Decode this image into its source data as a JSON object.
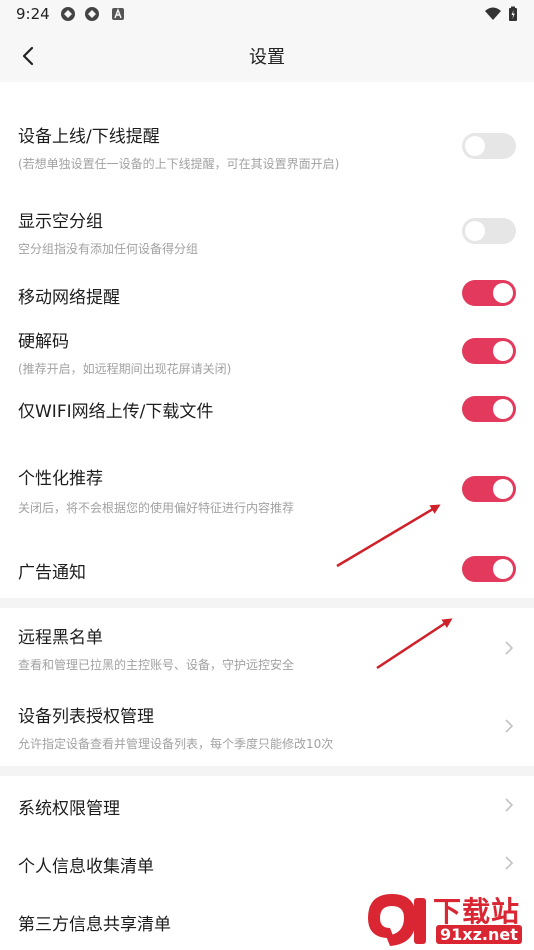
{
  "status_bar": {
    "time": "9:24"
  },
  "header": {
    "title": "设置"
  },
  "settings": [
    {
      "title": "设备上线/下线提醒",
      "subtitle": "(若想单独设置任一设备的上下线提醒，可在其设置界面开启)",
      "toggle": "off"
    },
    {
      "title": "显示空分组",
      "subtitle": "空分组指没有添加任何设备得分组",
      "toggle": "off"
    },
    {
      "title": "移动网络提醒",
      "subtitle": "",
      "toggle": "on"
    },
    {
      "title": "硬解码",
      "subtitle": "(推荐开启，如远程期间出现花屏请关闭)",
      "toggle": "on"
    },
    {
      "title": "仅WIFI网络上传/下载文件",
      "subtitle": "",
      "toggle": "on"
    },
    {
      "title": "个性化推荐",
      "subtitle": "关闭后，将不会根据您的使用偏好特征进行内容推荐",
      "toggle": "on"
    },
    {
      "title": "广告通知",
      "subtitle": "",
      "toggle": "on"
    }
  ],
  "management": [
    {
      "title": "远程黑名单",
      "subtitle": "查看和管理已拉黑的主控账号、设备，守护远控安全"
    },
    {
      "title": "设备列表授权管理",
      "subtitle": "允许指定设备查看并管理设备列表，每个季度只能修改10次"
    }
  ],
  "privacy": [
    {
      "title": "系统权限管理"
    },
    {
      "title": "个人信息收集清单"
    },
    {
      "title": "第三方信息共享清单"
    }
  ],
  "watermark": {
    "brand": "下载站",
    "url": "91xz.net"
  },
  "colors": {
    "accent": "#e2395d",
    "toggle_off": "#e6e6e6",
    "annotation_arrow": "#d0202a"
  }
}
